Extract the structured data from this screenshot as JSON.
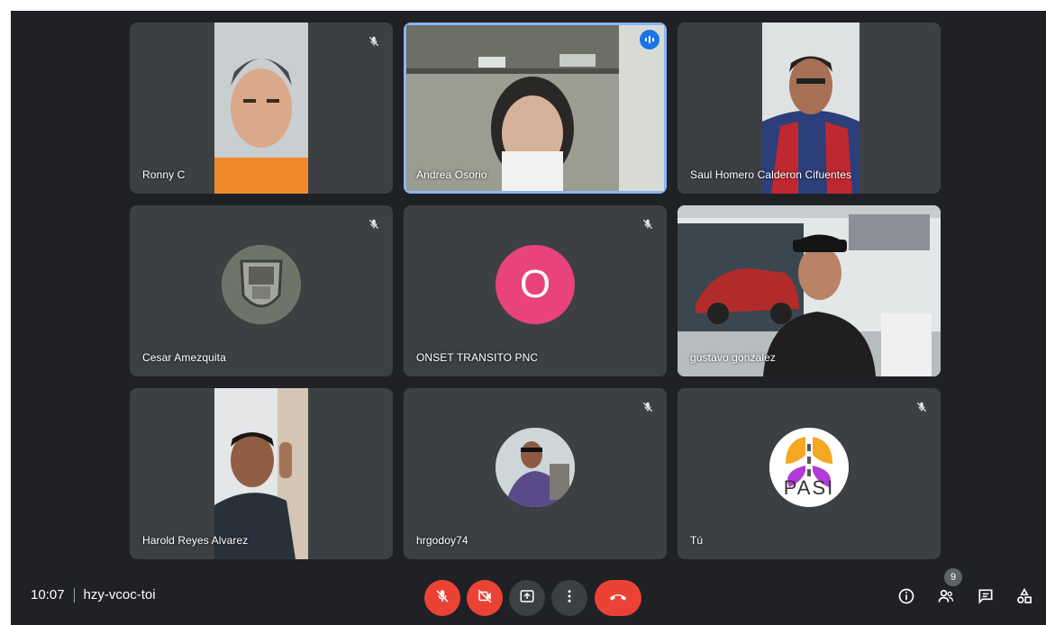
{
  "meeting": {
    "time": "10:07",
    "code": "hzy-vcoc-toi",
    "participant_count": "9"
  },
  "participants": [
    {
      "name": "Ronny C",
      "muted": true
    },
    {
      "name": "Andrea Osorio",
      "muted": false,
      "speaking": true
    },
    {
      "name": "Saul Homero Calderon Cifuentes",
      "muted": false
    },
    {
      "name": "Cesar Amezquita",
      "muted": true
    },
    {
      "name": "ONSET TRANSITO PNC",
      "muted": true,
      "avatar_letter": "O"
    },
    {
      "name": "gustavo gonzalez",
      "muted": false
    },
    {
      "name": "Harold Reyes Alvarez",
      "muted": false
    },
    {
      "name": "hrgodoy74",
      "muted": true
    },
    {
      "name": "Tú",
      "muted": true,
      "logo_text": "PASI"
    }
  ],
  "controls": [
    {
      "name": "mic-off-icon"
    },
    {
      "name": "camera-off-icon"
    },
    {
      "name": "present-screen-icon"
    },
    {
      "name": "more-options-icon"
    },
    {
      "name": "end-call-icon"
    }
  ],
  "side_icons": [
    "info-icon",
    "people-icon",
    "chat-icon",
    "activities-icon"
  ],
  "colors": {
    "background": "#202124",
    "tile": "#3c4043",
    "accent_red": "#ea4335",
    "speaking_blue": "#1a73e8",
    "avatar_pink": "#e8437a"
  }
}
